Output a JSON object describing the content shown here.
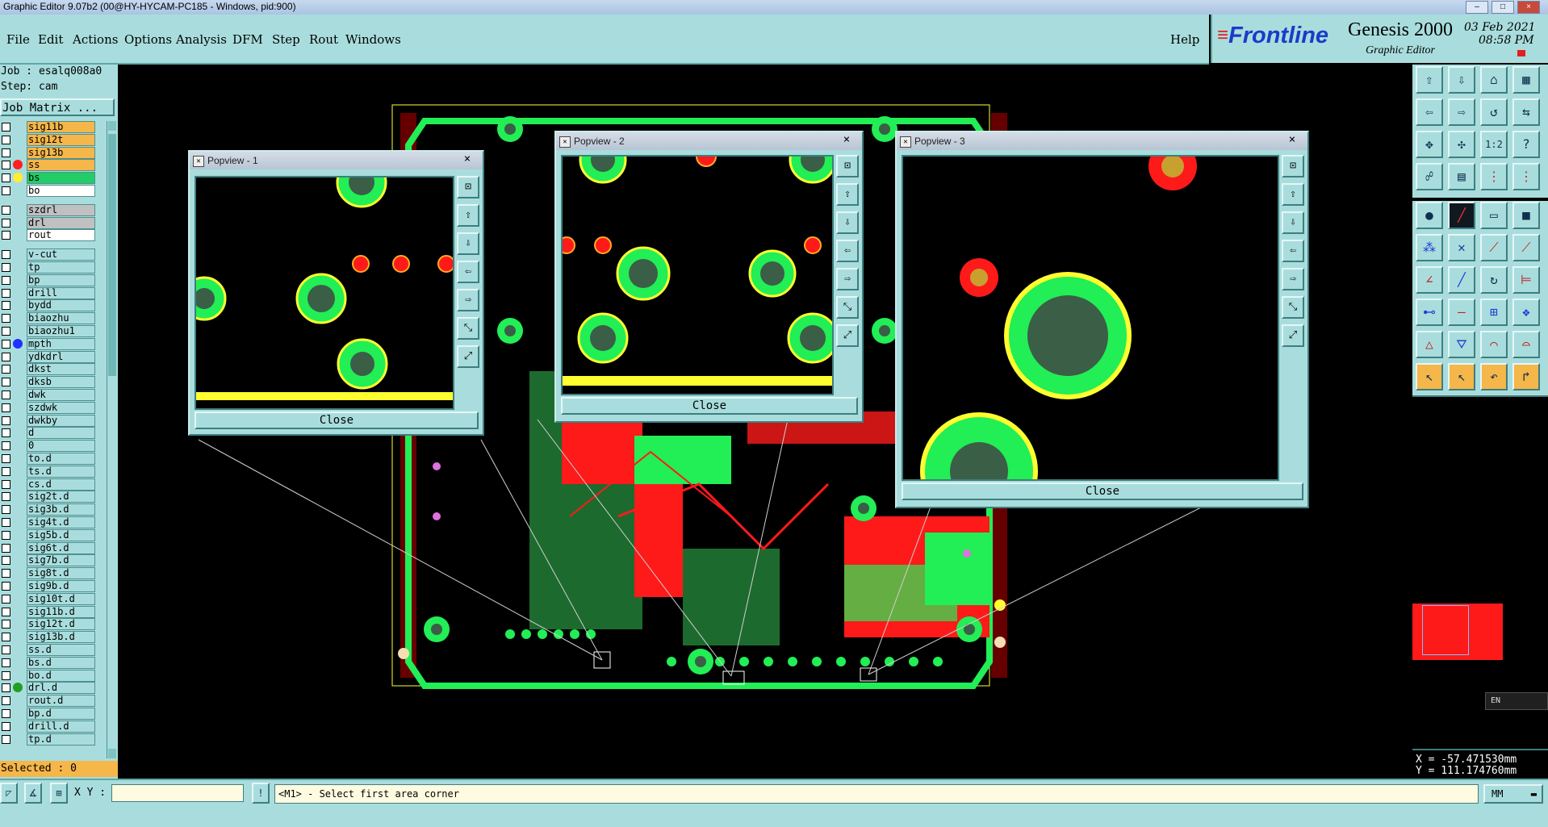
{
  "window": {
    "title": "Graphic Editor 9.07b2 (00@HY-HYCAM-PC185 - Windows, pid:900)"
  },
  "menu": {
    "items": [
      "File",
      "Edit",
      "Actions",
      "Options",
      "Analysis",
      "DFM",
      "Step",
      "Rout",
      "Windows"
    ],
    "help": "Help"
  },
  "brand": {
    "logo": "Frontline",
    "product": "Genesis 2000",
    "subtitle": "Graphic Editor",
    "date": "03 Feb 2021",
    "time": "08:58 PM"
  },
  "job": {
    "job_label": "Job : esalq008a0",
    "step_label": "Step: cam",
    "matrix_button": "Job Matrix ..."
  },
  "layers": [
    {
      "name": "sig11b",
      "state": "orange",
      "dot": ""
    },
    {
      "name": "sig12t",
      "state": "orange",
      "dot": ""
    },
    {
      "name": "sig13b",
      "state": "orange",
      "dot": ""
    },
    {
      "name": "ss",
      "state": "orange",
      "dot": "#ff2020"
    },
    {
      "name": "bs",
      "state": "green",
      "dot": "#ffee30"
    },
    {
      "name": "bo",
      "state": "white",
      "dot": ""
    },
    {
      "name": "szdrl",
      "state": "grey",
      "dot": ""
    },
    {
      "name": "drl",
      "state": "grey",
      "dot": ""
    },
    {
      "name": "rout",
      "state": "white",
      "dot": ""
    },
    {
      "name": "v-cut",
      "state": "teal",
      "dot": ""
    },
    {
      "name": "tp",
      "state": "teal",
      "dot": ""
    },
    {
      "name": "bp",
      "state": "teal",
      "dot": ""
    },
    {
      "name": "drill",
      "state": "teal",
      "dot": ""
    },
    {
      "name": "bydd",
      "state": "teal",
      "dot": ""
    },
    {
      "name": "biaozhu",
      "state": "teal",
      "dot": ""
    },
    {
      "name": "biaozhu1",
      "state": "teal",
      "dot": ""
    },
    {
      "name": "mpth",
      "state": "teal",
      "dot": "#2030ff"
    },
    {
      "name": "ydkdrl",
      "state": "teal",
      "dot": ""
    },
    {
      "name": "dkst",
      "state": "teal",
      "dot": ""
    },
    {
      "name": "dksb",
      "state": "teal",
      "dot": ""
    },
    {
      "name": "dwk",
      "state": "teal",
      "dot": ""
    },
    {
      "name": "szdwk",
      "state": "teal",
      "dot": ""
    },
    {
      "name": "dwkby",
      "state": "teal",
      "dot": ""
    },
    {
      "name": "d",
      "state": "teal",
      "dot": ""
    },
    {
      "name": "0",
      "state": "teal",
      "dot": ""
    },
    {
      "name": "to.d",
      "state": "teal",
      "dot": ""
    },
    {
      "name": "ts.d",
      "state": "teal",
      "dot": ""
    },
    {
      "name": "cs.d",
      "state": "teal",
      "dot": ""
    },
    {
      "name": "sig2t.d",
      "state": "teal",
      "dot": ""
    },
    {
      "name": "sig3b.d",
      "state": "teal",
      "dot": ""
    },
    {
      "name": "sig4t.d",
      "state": "teal",
      "dot": ""
    },
    {
      "name": "sig5b.d",
      "state": "teal",
      "dot": ""
    },
    {
      "name": "sig6t.d",
      "state": "teal",
      "dot": ""
    },
    {
      "name": "sig7b.d",
      "state": "teal",
      "dot": ""
    },
    {
      "name": "sig8t.d",
      "state": "teal",
      "dot": ""
    },
    {
      "name": "sig9b.d",
      "state": "teal",
      "dot": ""
    },
    {
      "name": "sig10t.d",
      "state": "teal",
      "dot": ""
    },
    {
      "name": "sig11b.d",
      "state": "teal",
      "dot": ""
    },
    {
      "name": "sig12t.d",
      "state": "teal",
      "dot": ""
    },
    {
      "name": "sig13b.d",
      "state": "teal",
      "dot": ""
    },
    {
      "name": "ss.d",
      "state": "teal",
      "dot": ""
    },
    {
      "name": "bs.d",
      "state": "teal",
      "dot": ""
    },
    {
      "name": "bo.d",
      "state": "teal",
      "dot": ""
    },
    {
      "name": "drl.d",
      "state": "teal",
      "dot": "#20a020"
    },
    {
      "name": "rout.d",
      "state": "teal",
      "dot": ""
    },
    {
      "name": "bp.d",
      "state": "teal",
      "dot": ""
    },
    {
      "name": "drill.d",
      "state": "teal",
      "dot": ""
    },
    {
      "name": "tp.d",
      "state": "teal",
      "dot": ""
    }
  ],
  "selection": {
    "selected_label": "Selected : 0"
  },
  "popviews": [
    {
      "title": "Popview - 1",
      "close_label": "Close",
      "close_x": "×"
    },
    {
      "title": "Popview - 2",
      "close_label": "Close",
      "close_x": "×"
    },
    {
      "title": "Popview - 3",
      "close_label": "Close",
      "close_x": "×"
    }
  ],
  "coords": {
    "x_readout": "X = -57.471530mm",
    "y_readout": "Y = 111.174760mm"
  },
  "bottom": {
    "xy_label": "X Y :",
    "xy_value": "",
    "message": "<M1> - Select first area corner",
    "units": "MM",
    "lang": "EN"
  },
  "colors": {
    "panel": "#a9dddd",
    "copper_green": "#22ee55",
    "copper_red": "#ff1a1a",
    "silk_yellow": "#ffff30",
    "pad_grey": "#3b5e47"
  }
}
